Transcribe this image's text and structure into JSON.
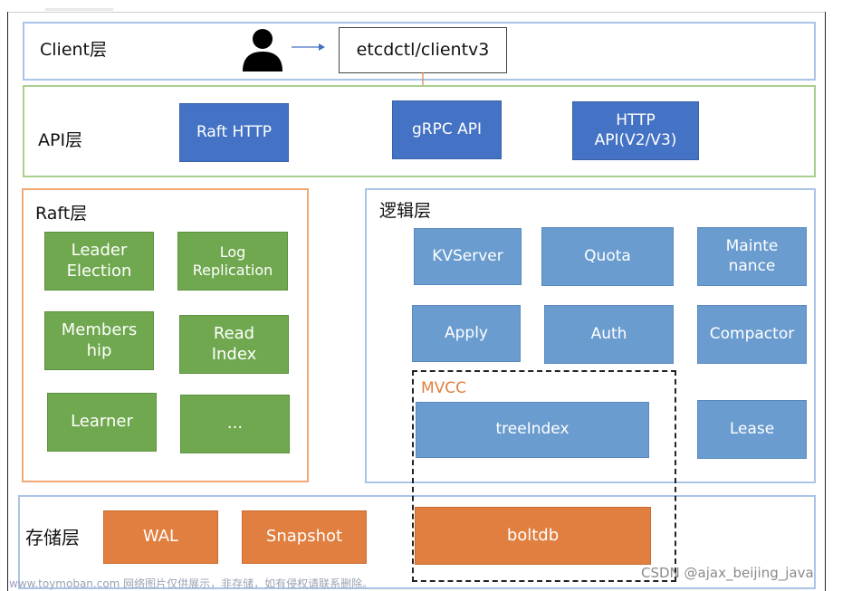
{
  "diagram": {
    "client_layer": {
      "title": "Client层",
      "user_icon": "user-icon",
      "client_box": "etcdctl/clientv3"
    },
    "api_layer": {
      "title": "API层",
      "boxes": [
        "Raft HTTP",
        "gRPC API",
        "HTTP\nAPI(V2/V3)"
      ]
    },
    "raft_layer": {
      "title": "Raft层",
      "boxes": [
        "Leader\nElection",
        "Log\nReplication",
        "Members\nhip",
        "Read\nIndex",
        "Learner",
        "..."
      ]
    },
    "logic_layer": {
      "title": "逻辑层",
      "boxes": [
        "KVServer",
        "Quota",
        "Mainte\nnance",
        "Apply",
        "Auth",
        "Compactor",
        "treeIndex",
        "Lease"
      ],
      "mvcc_label": "MVCC"
    },
    "storage_layer": {
      "title": "存储层",
      "boxes": [
        "WAL",
        "Snapshot",
        "boltdb"
      ]
    },
    "colors": {
      "api_box": "#4472c4",
      "raft_box": "#70a84f",
      "logic_box": "#6a9ccf",
      "storage_box": "#e07f40",
      "mvcc_label": "#e07f40"
    }
  },
  "watermarks": {
    "site": "www.toymoban.com 网络图片仅供展示，非存储，如有侵权请联系删除。",
    "author": "CSDN @ajax_beijing_java"
  }
}
